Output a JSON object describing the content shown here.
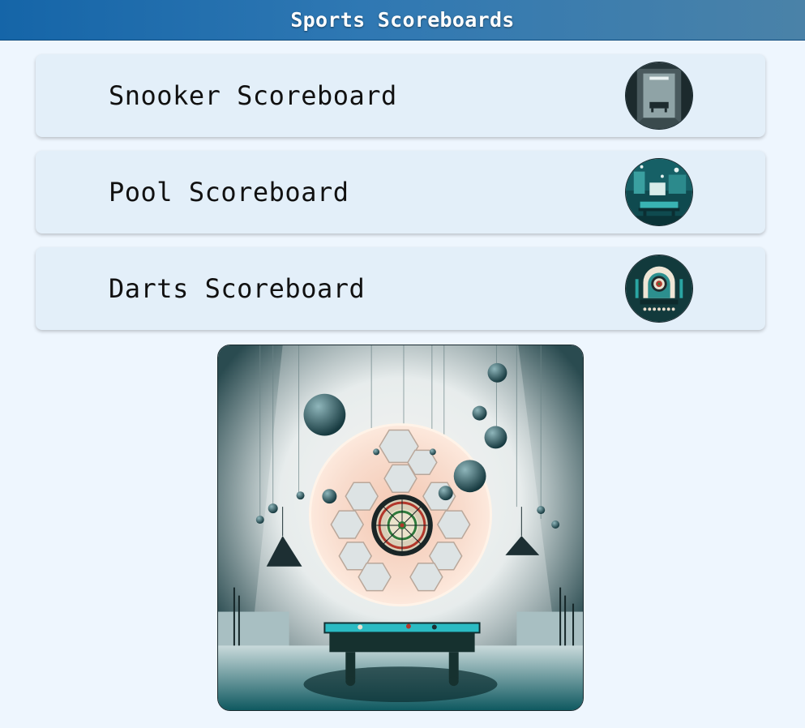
{
  "header": {
    "title": "Sports Scoreboards"
  },
  "cards": [
    {
      "label": "Snooker Scoreboard",
      "thumb_icon": "snooker-room-image"
    },
    {
      "label": "Pool Scoreboard",
      "thumb_icon": "pool-room-image"
    },
    {
      "label": "Darts Scoreboard",
      "thumb_icon": "darts-room-image"
    }
  ],
  "hero": {
    "image_icon": "dartboard-and-pool-table-illustration"
  },
  "colors": {
    "background": "#eef6fe",
    "header_start": "#1565a8",
    "header_end": "#4a82a8",
    "card": "#e3eff9",
    "teal": "#1f8c94"
  }
}
